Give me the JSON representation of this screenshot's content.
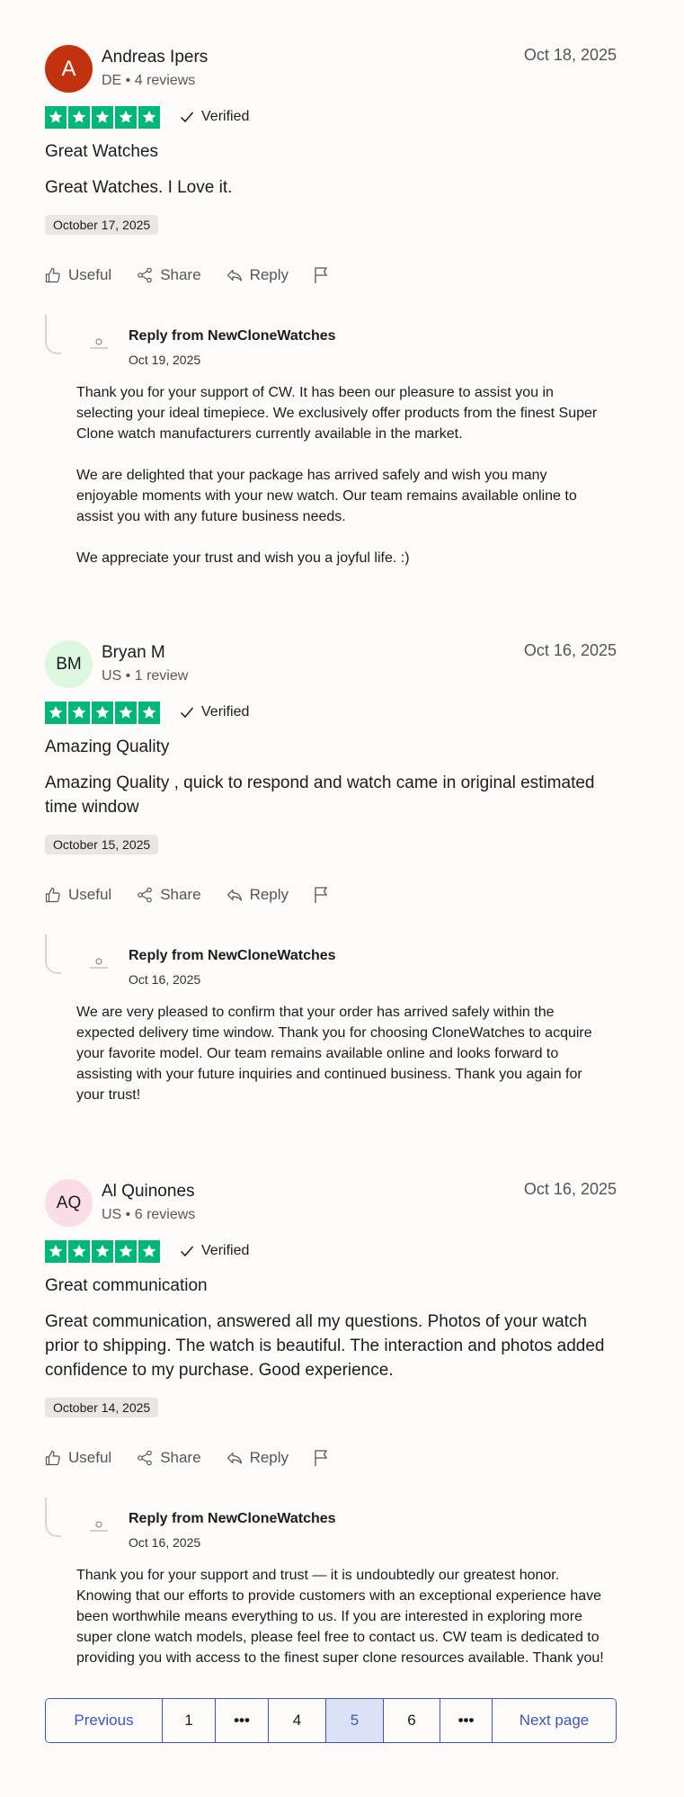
{
  "reviews": [
    {
      "avatar_text": "A",
      "avatar_bg": "#c1320e",
      "avatar_fg": "#ffffff",
      "name": "Andreas Ipers",
      "meta": "DE • 4 reviews",
      "date": "Oct 18, 2025",
      "rating": 5,
      "verified_label": "Verified",
      "title": "Great Watches",
      "body": "Great Watches. I Love it.",
      "experience_date": "October 17, 2025",
      "actions": {
        "useful": "Useful",
        "share": "Share",
        "reply": "Reply"
      },
      "reply": {
        "from": "Reply from NewCloneWatches",
        "date": "Oct 19, 2025",
        "text": "Thank you for your support of CW. It has been our pleasure to assist you in selecting your ideal timepiece. We exclusively offer products from the finest Super Clone watch manufacturers currently available in the market.\n\nWe are delighted that your package has arrived safely and wish you many enjoyable moments with your new watch. Our team remains available online to assist you with any future business needs.\n\nWe appreciate your trust and wish you a joyful life. :)"
      }
    },
    {
      "avatar_text": "BM",
      "avatar_bg": "#dcf8e0",
      "avatar_fg": "#1c1c1c",
      "name": "Bryan M",
      "meta": "US • 1 review",
      "date": "Oct 16, 2025",
      "rating": 5,
      "verified_label": "Verified",
      "title": "Amazing Quality",
      "body": "Amazing Quality , quick to respond and watch came in original estimated time window",
      "experience_date": "October 15, 2025",
      "actions": {
        "useful": "Useful",
        "share": "Share",
        "reply": "Reply"
      },
      "reply": {
        "from": "Reply from NewCloneWatches",
        "date": "Oct 16, 2025",
        "text": "We are very pleased to confirm that your order has arrived safely within the expected delivery time window. Thank you for choosing CloneWatches to acquire your favorite model. Our team remains available online and looks forward to assisting with your future inquiries and continued business. Thank you again for your trust!"
      }
    },
    {
      "avatar_text": "AQ",
      "avatar_bg": "#fbdde7",
      "avatar_fg": "#1c1c1c",
      "name": "Al Quinones",
      "meta": "US • 6 reviews",
      "date": "Oct 16, 2025",
      "rating": 5,
      "verified_label": "Verified",
      "title": "Great communication",
      "body": "Great communication, answered all my questions. Photos of your watch prior to shipping. The watch is beautiful. The interaction and photos added confidence to my purchase. Good experience.",
      "experience_date": "October 14, 2025",
      "actions": {
        "useful": "Useful",
        "share": "Share",
        "reply": "Reply"
      },
      "reply": {
        "from": "Reply from NewCloneWatches",
        "date": "Oct 16, 2025",
        "text": "Thank you for your support and trust — it is undoubtedly our greatest honor. Knowing that our efforts to provide customers with an exceptional experience have been worthwhile means everything to us. If you are interested in exploring more super clone watch models, please feel free to contact us. CW team is dedicated to providing you with access to the finest super clone resources available. Thank you!"
      }
    }
  ],
  "pagination": {
    "previous": "Previous",
    "pages": [
      "1",
      "•••",
      "4",
      "5",
      "6",
      "•••"
    ],
    "current": "5",
    "next": "Next page"
  },
  "colors": {
    "star_green": "#00b67a",
    "link_blue": "#3c57bc"
  }
}
